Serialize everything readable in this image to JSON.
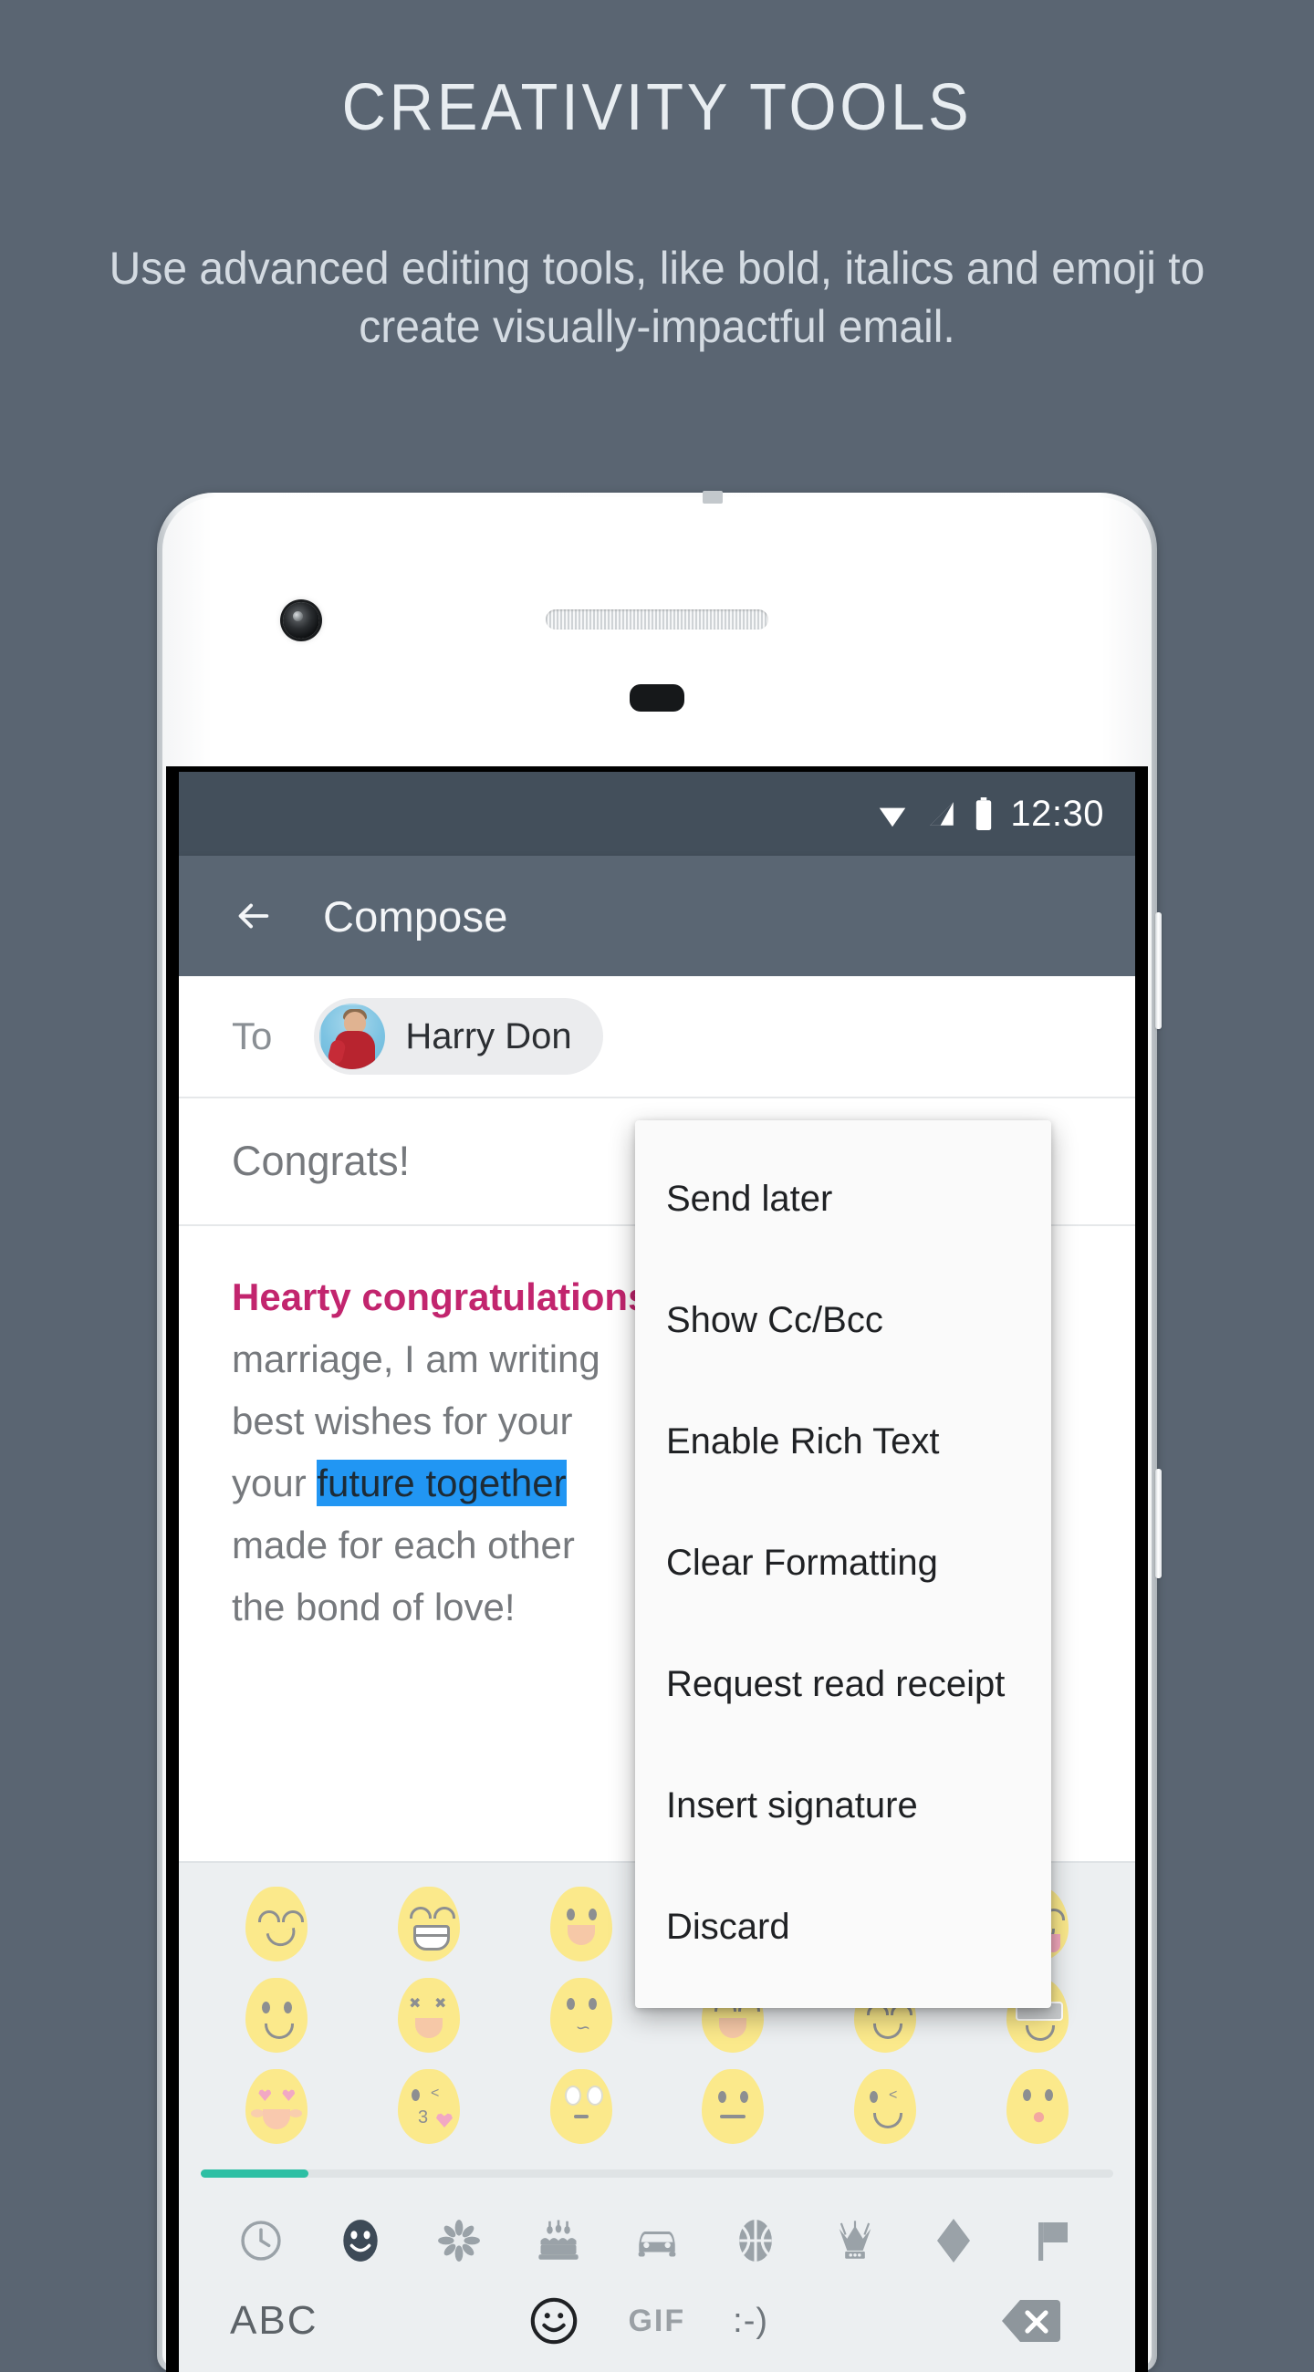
{
  "promo": {
    "title": "CREATIVITY TOOLS",
    "subtitle": "Use advanced editing tools, like bold, italics and emoji to create visually-impactful email.",
    "background_color": "#5a6572",
    "title_color": "#e8edf1"
  },
  "status_bar": {
    "time": "12:30",
    "icons": [
      "wifi-icon",
      "signal-icon",
      "battery-icon"
    ],
    "background_color": "#434f5b"
  },
  "app_bar": {
    "back_label": "back-arrow-icon",
    "title": "Compose",
    "background_color": "#5a6673"
  },
  "compose": {
    "to_label": "To",
    "recipient": "Harry Don",
    "subject": "Congrats!",
    "body_lines": [
      {
        "text": "Hearty congratulations",
        "style": "heading"
      },
      {
        "text": "marriage, I am writing",
        "style": "normal"
      },
      {
        "text": "best wishes for your",
        "style": "normal"
      },
      {
        "pre": "your ",
        "highlight": "future together",
        "style": "normal"
      },
      {
        "text": "made for each other",
        "style": "normal"
      },
      {
        "text": "the bond of love!",
        "style": "normal"
      }
    ],
    "heading_color": "#c2256e",
    "highlight_color": "#2196f3",
    "body_color": "#76797d"
  },
  "menu": {
    "items": [
      {
        "label": "Send later"
      },
      {
        "label": "Show Cc/Bcc"
      },
      {
        "label": "Enable Rich Text"
      },
      {
        "label": "Clear Formatting"
      },
      {
        "label": "Request read receipt"
      },
      {
        "label": "Insert signature"
      },
      {
        "label": "Discard"
      }
    ],
    "background_color": "#fafafa"
  },
  "keyboard": {
    "background_color": "#eceff1",
    "emoji_rows": [
      [
        "smirking-face-emoji",
        "grinning-face-emoji",
        "open-mouth-face-emoji",
        "thinking-face-emoji",
        "expressionless-face-emoji",
        "savoring-food-face-emoji"
      ],
      [
        "slightly-smiling-face-emoji",
        "squinting-laugh-face-emoji",
        "kissing-face-emoji",
        "laughing-face-emoji",
        "smiling-face-emoji",
        "sunglasses-face-emoji"
      ],
      [
        "heart-eyes-face-emoji",
        "blowing-kiss-face-emoji",
        "rolling-eyes-face-emoji",
        "neutral-face-emoji",
        "winking-face-emoji",
        "surprised-face-emoji"
      ]
    ],
    "scroll_indicator": {
      "color": "#2dbfa4",
      "position_percent": 0
    },
    "categories": [
      "clock-recent-icon",
      "smiley-people-icon",
      "flower-nature-icon",
      "cake-food-icon",
      "car-travel-icon",
      "basketball-activity-icon",
      "crown-objects-icon",
      "diamond-symbols-icon",
      "flag-icon"
    ],
    "active_category_index": 1,
    "bottom_bar": {
      "abc_label": "ABC",
      "emoji_toggle": "smiley-outline-icon",
      "gif_label": "GIF",
      "emoticon_label": ":-)",
      "backspace": "backspace-icon"
    }
  }
}
